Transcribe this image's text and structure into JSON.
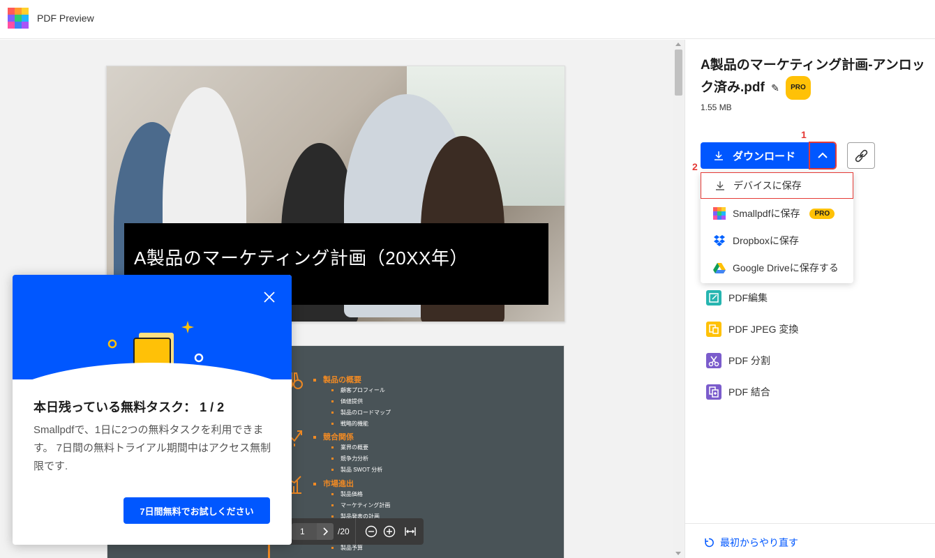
{
  "app": {
    "title": "PDF Preview",
    "logo_colors": [
      "#ff5a5a",
      "#ff9a2e",
      "#ffd02b",
      "#7b61ff",
      "#2ecc71",
      "#1fb6ff",
      "#ff4fa3",
      "#3b82f6",
      "#a855f7"
    ]
  },
  "preview": {
    "page1_title": "A製品のマーケティング計画（20XX年）",
    "page2_sections": [
      {
        "heading": "製品の概要",
        "items": [
          "顧客プロフィール",
          "価値提供",
          "製品のロードマップ",
          "戦略的機能"
        ]
      },
      {
        "heading": "競合関係",
        "items": [
          "業界の概要",
          "競争力分析",
          "製品 SWOT 分析"
        ]
      },
      {
        "heading": "市場進出",
        "items": [
          "製品価格",
          "マーケティング計画",
          "製品発表の計画"
        ]
      }
    ],
    "page2_trailing_item": "製品予算",
    "pager": {
      "current_page": "1",
      "total": "/20"
    }
  },
  "modal": {
    "title": "本日残っている無料タスク： 1 / 2",
    "body": "Smallpdfで、1日に2つの無料タスクを利用できます。 7日間の無料トライアル期間中はアクセス無制限です.",
    "cta": "7日間無料でお試しください"
  },
  "panel": {
    "file_name": "A製品のマーケティング計画-アンロック済み.pdf",
    "pro_badge": "PRO",
    "file_size": "1.55 MB",
    "download_label": "ダウンロード",
    "marker_1": "1",
    "marker_2": "2",
    "dropdown": [
      {
        "label": "デバイスに保存",
        "icon": "download-icon"
      },
      {
        "label": "Smallpdfに保存",
        "icon": "smallpdf-icon",
        "badge": "PRO"
      },
      {
        "label": "Dropboxに保存",
        "icon": "dropbox-icon"
      },
      {
        "label": "Google Driveに保存する",
        "icon": "google-drive-icon"
      }
    ],
    "tools": [
      {
        "label": "PDF編集",
        "color": "#26b5b0"
      },
      {
        "label": "PDF JPEG 変換",
        "color": "#ffc107"
      },
      {
        "label": "PDF 分割",
        "color": "#7b5ccc"
      },
      {
        "label": "PDF 結合",
        "color": "#7b5ccc"
      }
    ],
    "restart_label": "最初からやり直す"
  },
  "colors": {
    "accent": "#0057ff",
    "highlight": "#e53935",
    "pro": "#ffc107"
  }
}
